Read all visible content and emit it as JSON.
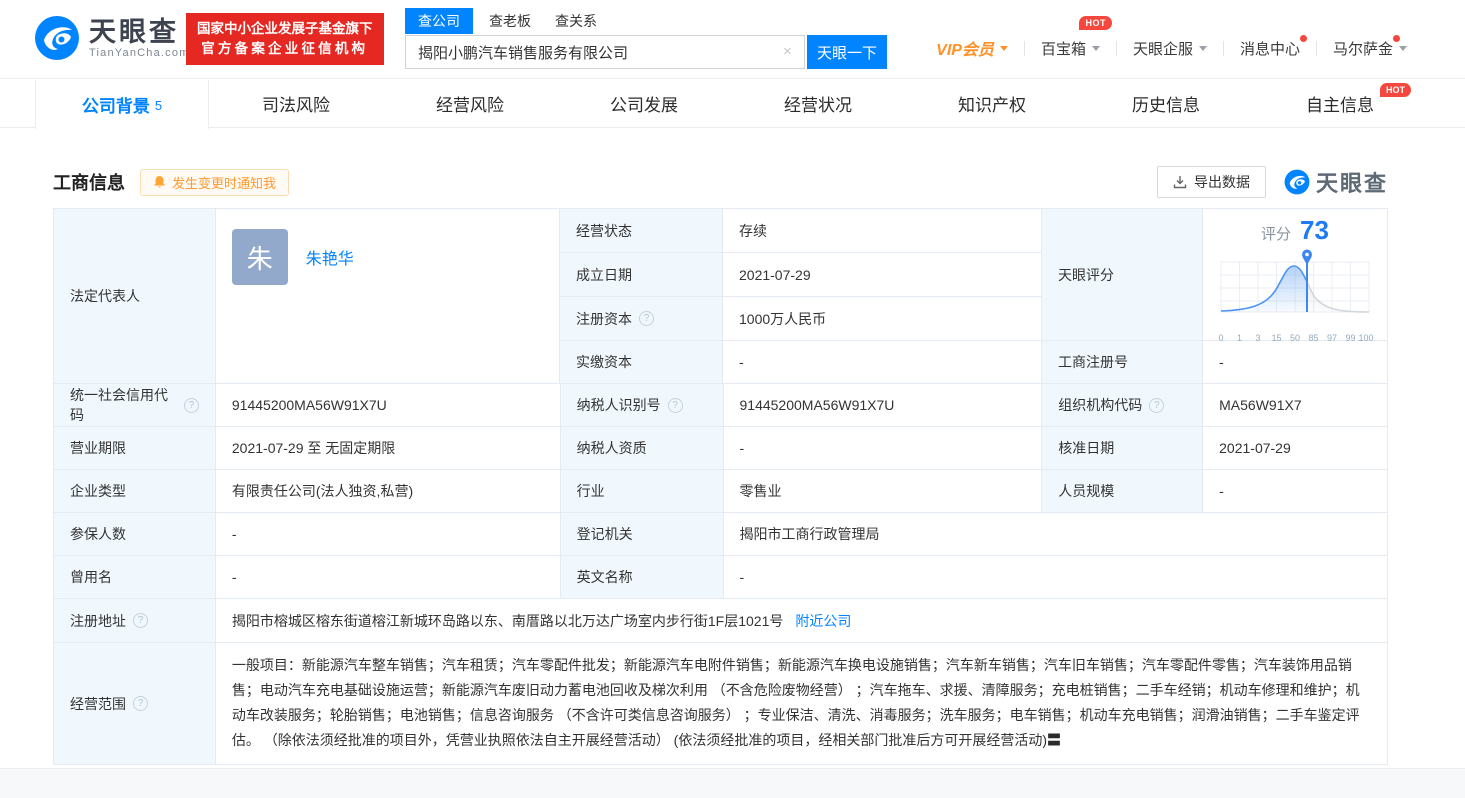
{
  "brand": {
    "name": "天眼查",
    "domain": "TianYanCha.com",
    "badge_line1": "国家中小企业发展子基金旗下",
    "badge_line2": "官方备案企业征信机构"
  },
  "search": {
    "tabs": [
      "查公司",
      "查老板",
      "查关系"
    ],
    "value": "揭阳小鹏汽车销售服务有限公司",
    "button": "天眼一下",
    "clear_glyph": "×"
  },
  "topnav": {
    "vip": "VIP会员",
    "toolbox": "百宝箱",
    "toolbox_hot": "HOT",
    "qifu": "天眼企服",
    "messages": "消息中心",
    "username": "马尔萨金"
  },
  "page_tabs": {
    "t0": "公司背景",
    "t0_count": "5",
    "t1": "司法风险",
    "t2": "经营风险",
    "t3": "公司发展",
    "t4": "经营状况",
    "t5": "知识产权",
    "t6": "历史信息",
    "t7": "自主信息",
    "t7_hot": "HOT"
  },
  "section": {
    "title": "工商信息",
    "notify": "发生变更时通知我",
    "export": "导出数据",
    "watermark": "天眼查"
  },
  "icons": {
    "help": "?",
    "more": "〓"
  },
  "score": {
    "label": "天眼评分",
    "word": "评分",
    "value": "73",
    "ticks": [
      "0",
      "1",
      "3",
      "15",
      "50",
      "85",
      "97",
      "99",
      "100"
    ]
  },
  "table": {
    "legal_rep": {
      "label": "法定代表人",
      "avatar": "朱",
      "name": "朱艳华"
    },
    "mid": [
      {
        "label": "经营状态",
        "value": "存续"
      },
      {
        "label": "成立日期",
        "value": "2021-07-29"
      },
      {
        "label": "注册资本",
        "value": "1000万人民币"
      },
      {
        "label": "实缴资本",
        "value": "-"
      }
    ],
    "reg_no": {
      "label": "工商注册号",
      "value": "-"
    },
    "r2": {
      "c1l": "统一社会信用代码",
      "c1v": "91445200MA56W91X7U",
      "c2l": "纳税人识别号",
      "c2v": "91445200MA56W91X7U",
      "c3l": "组织机构代码",
      "c3v": "MA56W91X7"
    },
    "r3": {
      "c1l": "营业期限",
      "c1v": "2021-07-29  至 无固定期限",
      "c2l": "纳税人资质",
      "c2v": "-",
      "c3l": "核准日期",
      "c3v": "2021-07-29"
    },
    "r4": {
      "c1l": "企业类型",
      "c1v": "有限责任公司(法人独资,私营)",
      "c2l": "行业",
      "c2v": "零售业",
      "c3l": "人员规模",
      "c3v": "-"
    },
    "r5": {
      "c1l": "参保人数",
      "c1v": "-",
      "c2l": "登记机关",
      "c2v": "揭阳市工商行政管理局"
    },
    "r6": {
      "c1l": "曾用名",
      "c1v": "-",
      "c2l": "英文名称",
      "c2v": "-"
    },
    "address": {
      "label": "注册地址",
      "value": "揭阳市榕城区榕东街道榕江新城环岛路以东、南厝路以北万达广场室内步行街1F层1021号",
      "link": "附近公司"
    },
    "scope": {
      "label": "经营范围",
      "value": "一般项目：新能源汽车整车销售；汽车租赁；汽车零配件批发；新能源汽车电附件销售；新能源汽车换电设施销售；汽车新车销售；汽车旧车销售；汽车零配件零售；汽车装饰用品销售；电动汽车充电基础设施运营；新能源汽车废旧动力蓄电池回收及梯次利用 （不含危险废物经营） ；汽车拖车、求援、清障服务；充电桩销售；二手车经销；机动车修理和维护；机动车改装服务；轮胎销售；电池销售；信息咨询服务 （不含许可类信息咨询服务） ；专业保洁、清洗、消毒服务；洗车服务；电车销售；机动车充电销售；润滑油销售；二手车鉴定评估。 （除依法须经批准的项目外，凭营业执照依法自主开展经营活动） (依法须经批准的项目，经相关部门批准后方可开展经营活动)"
    }
  }
}
